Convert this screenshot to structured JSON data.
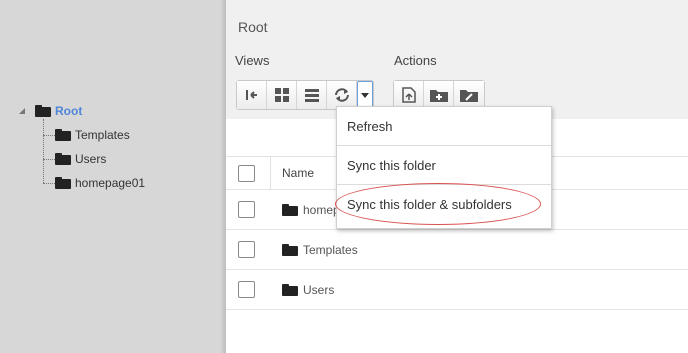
{
  "tree": {
    "root": "Root",
    "children": [
      "Templates",
      "Users",
      "homepage01"
    ]
  },
  "main": {
    "title": "Root",
    "views_label": "Views",
    "actions_label": "Actions"
  },
  "dropdown": {
    "items": [
      "Refresh",
      "Sync this folder",
      "Sync this folder & subfolders"
    ]
  },
  "table": {
    "column": "Name",
    "rows": [
      "homep",
      "Templates",
      "Users"
    ]
  },
  "colors": {
    "accent": "#4f86d8",
    "highlight": "#d9534f"
  }
}
